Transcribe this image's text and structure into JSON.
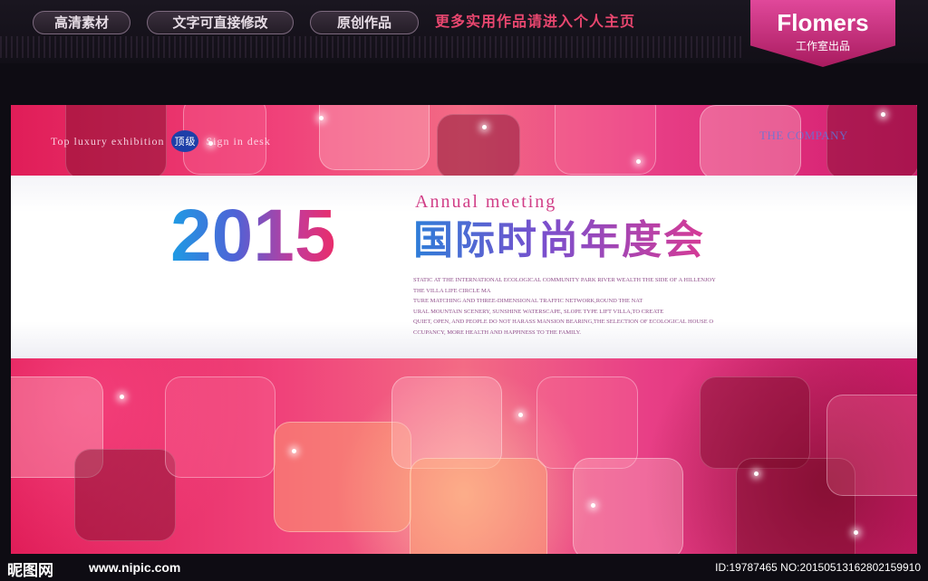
{
  "topbar": {
    "pills": [
      "高清素材",
      "文字可直接修改",
      "原创作品"
    ],
    "promo": "更多实用作品请进入个人主页",
    "brand_name": "Flomers",
    "brand_sub": "工作室出品"
  },
  "banner": {
    "tagline_left_1": "Top luxury exhibition",
    "tagline_badge": "顶级",
    "tagline_left_2": "Sign in desk",
    "company": "THE COMPANY",
    "year": "2015",
    "annual": "Annual meeting",
    "title_cn": "国际时尚年度会",
    "paragraph": [
      "STATIC AT THE INTERNATIONAL ECOLOGICAL COMMUNITY PARK RIVER WEALTH THE SIDE OF A HILLENJOY",
      "THE VILLA LIFE CIRCLE MA",
      "TURE MATCHING AND THREE-DIMENSIONAL TRAFFIC NETWORK,ROUND THE NAT",
      "URAL MOUNTAIN SCENERY, SUNSHINE WATERSCAPE, SLOPE TYPE LIFT VILLA,TO CREATE",
      "QUIET, OPEN, AND PEOPLE DO NOT HARASS MANSION BEARING,THE SELECTION OF ECOLOGICAL HOUSE O",
      "CCUPANCY, MORE HEALTH AND HAPPINESS TO THE FAMILY."
    ]
  },
  "footer": {
    "logo": "昵图网",
    "url": "www.nipic.com",
    "id_text": "ID:19787465 NO:20150513162802159910"
  },
  "colors": {
    "accent_pink": "#e9476f",
    "brand_magenta": "#c92a7a",
    "year_start": "#1d9ce4",
    "year_end": "#ea2d6a"
  }
}
